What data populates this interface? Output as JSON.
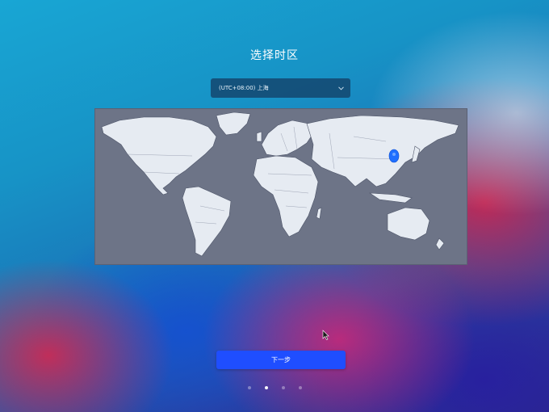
{
  "page": {
    "title": "选择时区"
  },
  "timezone_select": {
    "value": "(UTC+08:00) 上海",
    "icon": "chevron-down-icon"
  },
  "map": {
    "selected_city_marker": "map-pin-icon",
    "colors": {
      "ocean": "#6d7487",
      "land": "#e6ebf2",
      "marker": "#1f6fff"
    }
  },
  "next_button": {
    "label": "下一步",
    "color": "#1f4eff"
  },
  "pagination": {
    "total_steps": 4,
    "current_step": 2
  }
}
